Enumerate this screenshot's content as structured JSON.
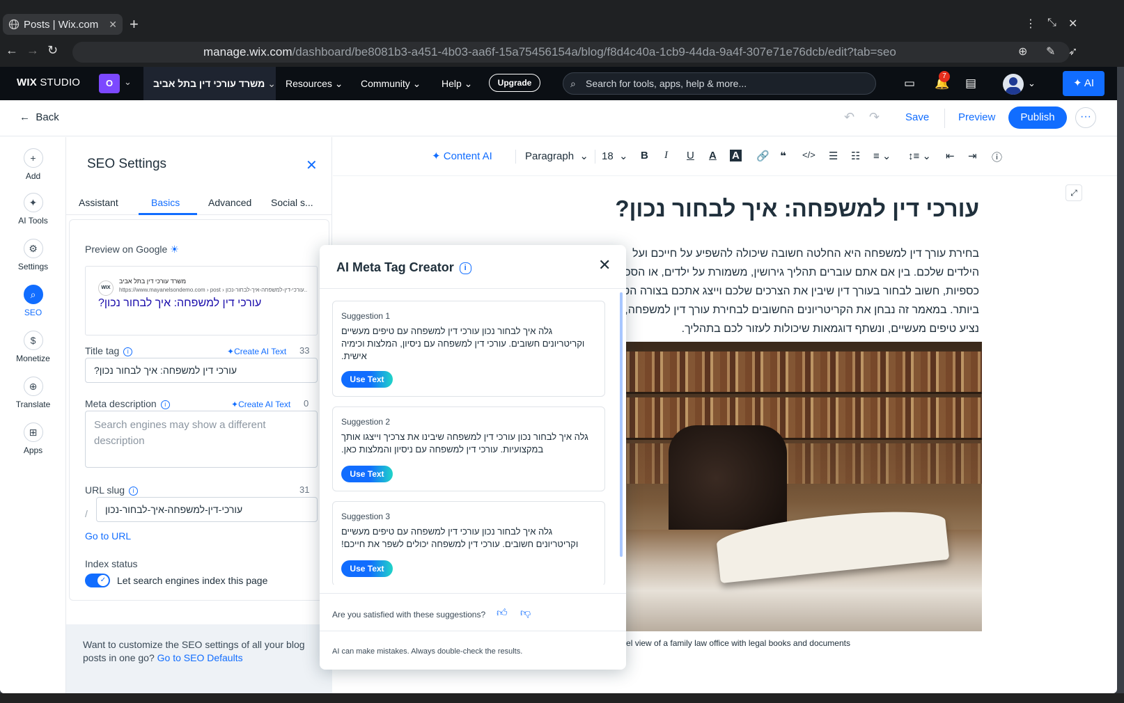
{
  "browser": {
    "tab_title": "Posts | Wix.com",
    "url_host": "manage.wix.com",
    "url_path": "/dashboard/be8081b3-a451-4b03-aa6f-15a75456154a/blog/f8d4c40a-1cb9-44da-9a4f-307e71e76dcb/edit?tab=seo"
  },
  "topbar": {
    "logo_bold": "WIX",
    "logo_rest": "STUDIO",
    "site_initial": "O",
    "site_name": "משרד עורכי דין בתל אביב",
    "nav": [
      "Resources",
      "Community",
      "Help"
    ],
    "upgrade_label": "Upgrade",
    "search_placeholder": "Search for tools, apps, help & more...",
    "notification_count": "7",
    "ai_label": "AI"
  },
  "editor_header": {
    "back_label": "Back",
    "save_label": "Save",
    "preview_label": "Preview",
    "publish_label": "Publish",
    "more_label": "···"
  },
  "rail": {
    "items": [
      {
        "label": "Add",
        "icon": "plus-icon"
      },
      {
        "label": "AI Tools",
        "icon": "sparkle-icon"
      },
      {
        "label": "Settings",
        "icon": "gear-icon"
      },
      {
        "label": "SEO",
        "icon": "search-icon"
      },
      {
        "label": "Monetize",
        "icon": "dollar-icon"
      },
      {
        "label": "Translate",
        "icon": "globe-icon"
      },
      {
        "label": "Apps",
        "icon": "apps-icon"
      }
    ]
  },
  "seo": {
    "title": "SEO Settings",
    "tabs": [
      "Assistant",
      "Basics",
      "Advanced",
      "Social s..."
    ],
    "preview_label": "Preview on Google",
    "google": {
      "badge": "WIX",
      "site": "משרד עורכי דין בתל אביב",
      "crumb": "https://www.mayanelsondemo.com › post › עורכי-דין-למשפחה-איך-לבחור-נכון...",
      "title": "עורכי דין למשפחה: איך לבחור נכון?"
    },
    "title_tag_label": "Title tag",
    "create_ai_text": "Create AI Text",
    "title_count": "33",
    "title_value": "עורכי דין למשפחה: איך לבחור נכון?",
    "meta_label": "Meta description",
    "meta_count": "0",
    "meta_placeholder": "Search engines may show a different description",
    "slug_label": "URL slug",
    "slug_count": "31",
    "slug_prefix": "/",
    "slug_value": "עורכי-דין-למשפחה-איך-לבחור-נכון",
    "go_to_url": "Go to URL",
    "index_label": "Index status",
    "index_toggle_label": "Let search engines index this page",
    "index_enabled": true,
    "footer_text": "Want to customize the SEO settings of all your blog posts in one go?",
    "footer_link": "Go to SEO Defaults"
  },
  "toolbar": {
    "content_ai": "Content AI",
    "paragraph": "Paragraph",
    "font_size": "18"
  },
  "article": {
    "title": "עורכי דין למשפחה: איך לבחור נכון?",
    "body": "בחירת עורך דין למשפחה היא החלטה חשובה שיכולה להשפיע על חייכם ועל הילדים שלכם. בין אם אתם עוברים תהליך גירושין, משמורת על ילדים, או הסכמות כספיות, חשוב לבחור בעורך דין שיבין את הצרכים שלכם וייצג אתכם בצורה הטובה ביותר. במאמר זה נבחן את הקריטריונים החשובים לבחירת עורך דין למשפחה, נציע טיפים מעשיים, ונשתף דוגמאות שיכולות לעזור לכם בתהליך.",
    "caption": "Eye-level view of a family law office with legal books and documents"
  },
  "modal": {
    "title": "AI Meta Tag Creator",
    "suggestions": [
      {
        "heading": "Suggestion 1",
        "text": "גלה איך לבחור נכון עורכי דין למשפחה עם טיפים מעשיים וקריטריונים חשובים. עורכי דין למשפחה עם ניסיון, המלצות וכימיה אישית."
      },
      {
        "heading": "Suggestion 2",
        "text": "גלה איך לבחור נכון עורכי דין למשפחה שיבינו את צרכיך וייצגו אותך במקצועיות. עורכי דין למשפחה עם ניסיון והמלצות כאן."
      },
      {
        "heading": "Suggestion 3",
        "text": "גלה איך לבחור נכון עורכי דין למשפחה עם טיפים מעשיים וקריטריונים חשובים. עורכי דין למשפחה יכולים לשפר את חייכם!"
      }
    ],
    "use_text_label": "Use Text",
    "feedback_question": "Are you satisfied with these suggestions?",
    "disclaimer": "AI can make mistakes. Always double-check the results."
  },
  "colors": {
    "accent": "#116dff",
    "topbar_bg": "#0b0f14",
    "site_badge": "#7c48ff",
    "notification": "#e62e1c"
  }
}
